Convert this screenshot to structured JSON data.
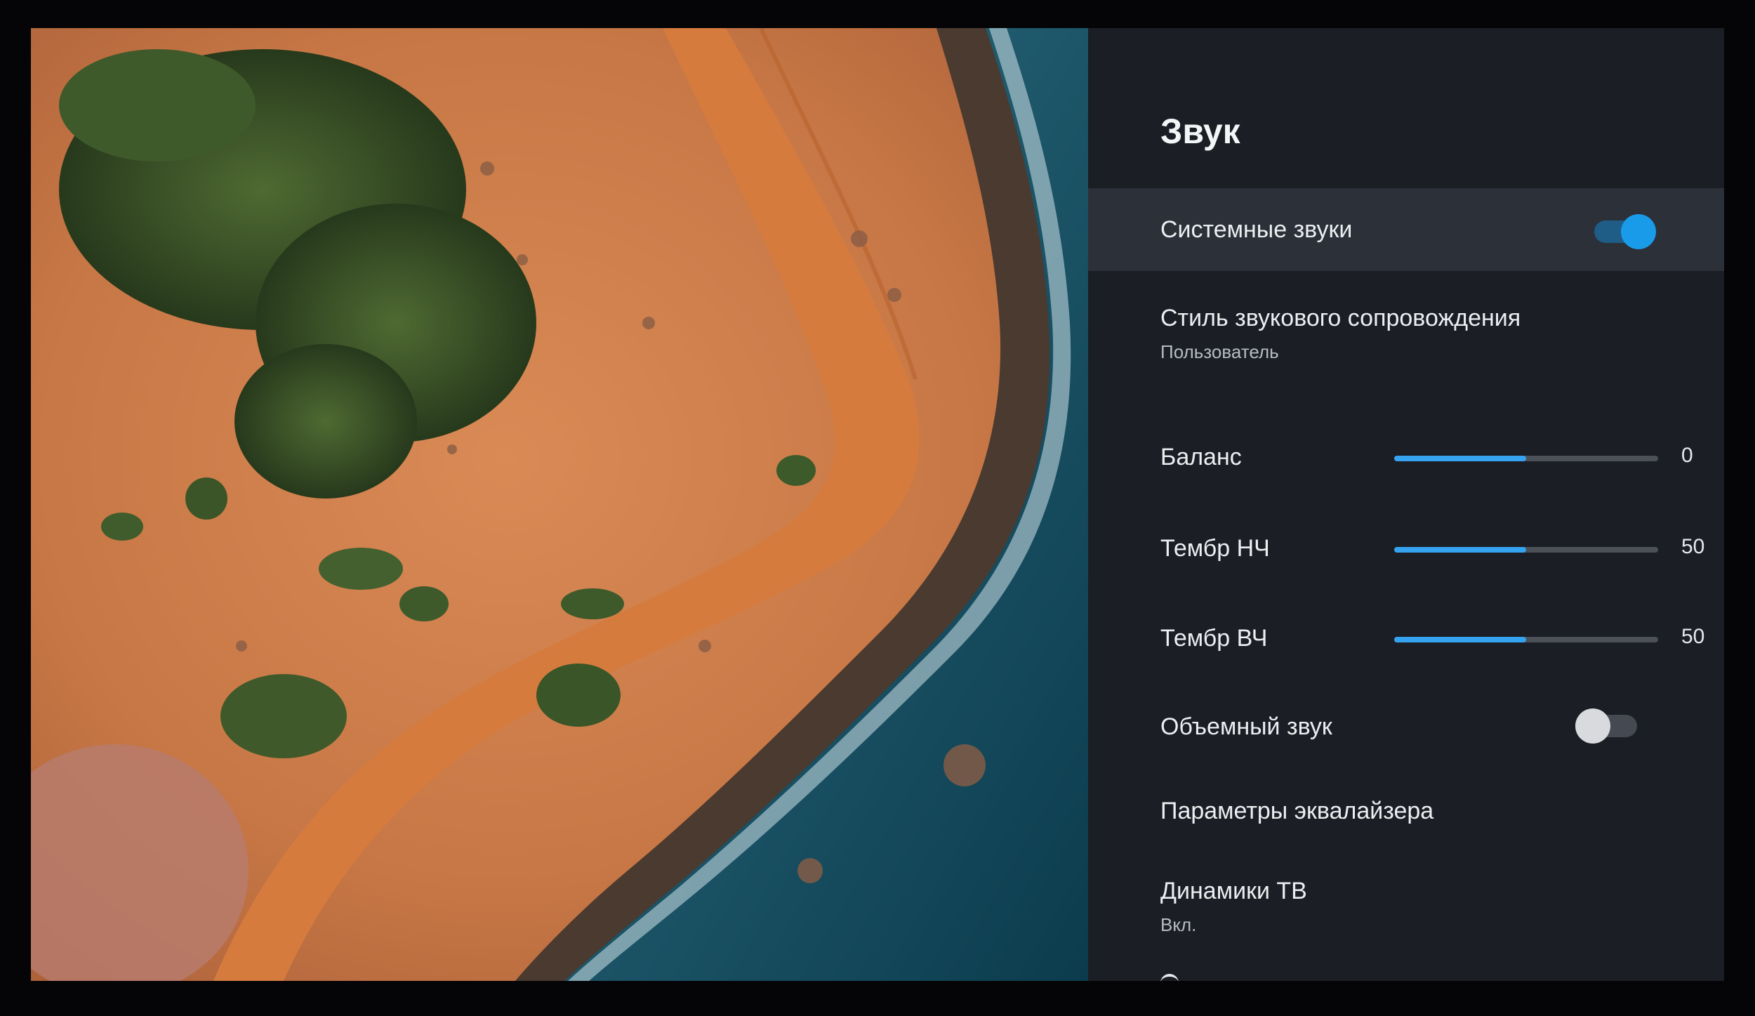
{
  "panel": {
    "title": "Звук"
  },
  "settings": {
    "system_sounds": {
      "label": "Системные звуки",
      "enabled": true
    },
    "sound_style": {
      "label": "Стиль звукового сопровождения",
      "value": "Пользователь"
    },
    "balance": {
      "label": "Баланс",
      "value": "0",
      "fill": 0.5
    },
    "bass": {
      "label": "Тембр НЧ",
      "value": "50",
      "fill": 0.5
    },
    "treble": {
      "label": "Тембр ВЧ",
      "value": "50",
      "fill": 0.5
    },
    "surround": {
      "label": "Объемный звук",
      "enabled": false
    },
    "equalizer": {
      "label": "Параметры эквалайзера"
    },
    "tv_speakers": {
      "label": "Динамики ТВ",
      "value": "Вкл."
    }
  },
  "colors": {
    "accent": "#1a9bea",
    "panel_background": "#1b1e24",
    "focused_row": "#2c3038"
  }
}
